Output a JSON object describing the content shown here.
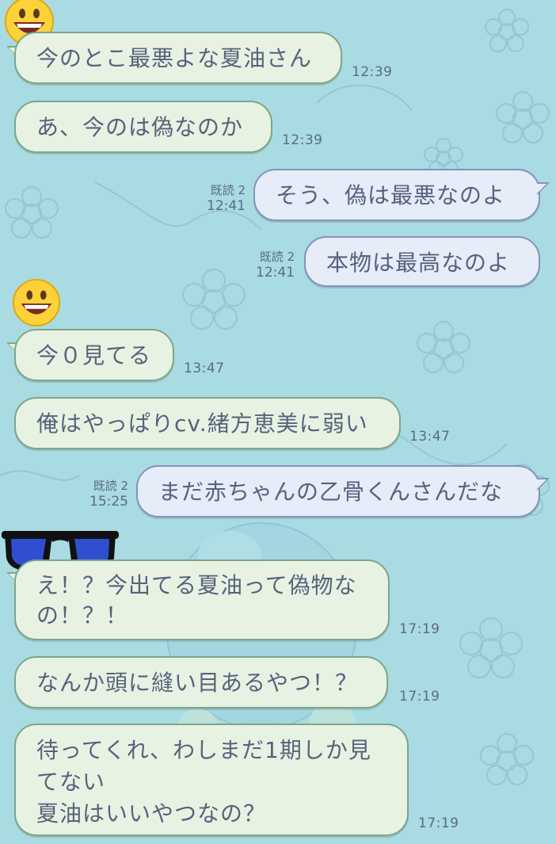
{
  "colors": {
    "background": "#a9dbe2",
    "incoming_bubble": "#e8f2e3",
    "outgoing_bubble": "#e6ecf8",
    "text": "#55637b"
  },
  "messages": [
    {
      "side": "in",
      "text": "今のとこ最悪よな夏油さん",
      "time": "12:39",
      "avatar": "smiley-emoji"
    },
    {
      "side": "in",
      "text": "あ、今のは偽なのか",
      "time": "12:39"
    },
    {
      "side": "out",
      "text": "そう、偽は最悪なのよ",
      "read": "既読 2",
      "time": "12:41"
    },
    {
      "side": "out",
      "text": "本物は最高なのよ",
      "read": "既読 2",
      "time": "12:41"
    },
    {
      "side": "in",
      "text": "今０見てる",
      "time": "13:47",
      "avatar": "smiley-emoji"
    },
    {
      "side": "in",
      "text": "俺はやっぱりcv.緒方恵美に弱い",
      "time": "13:47"
    },
    {
      "side": "out",
      "text": "まだ赤ちゃんの乙骨くんさんだな",
      "read": "既読 2",
      "time": "15:25"
    },
    {
      "side": "in",
      "lines": [
        "え！？今出てる夏油って偽物な",
        "の！？！"
      ],
      "time": "17:19",
      "avatar": "sunglasses-emoji"
    },
    {
      "side": "in",
      "text": "なんか頭に縫い目あるやつ！？",
      "time": "17:19"
    },
    {
      "side": "in",
      "lines": [
        "待ってくれ、わしまだ1期しか見",
        "てない",
        "夏油はいいやつなの？"
      ],
      "time": "17:19"
    }
  ]
}
